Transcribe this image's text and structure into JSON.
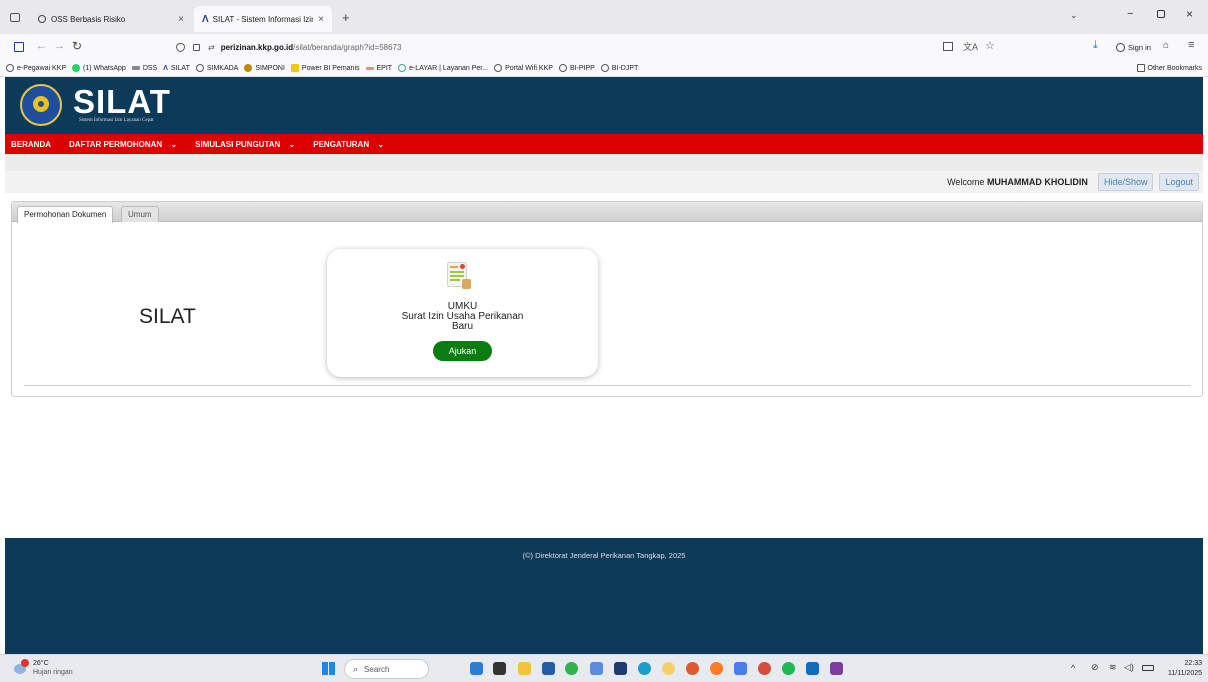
{
  "browser": {
    "tabs": [
      {
        "title": "OSS Berbasis Risiko"
      },
      {
        "title": "SILAT - Sistem Informasi Izin La"
      }
    ],
    "new_tab_symbol": "+",
    "url_host": "perizinan.kkp.go.id",
    "url_path": "/silat/beranda/graph?id=58673",
    "sign_in_label": "Sign in",
    "bookmarks": [
      "e-Pegawai KKP",
      "(1) WhatsApp",
      "DSS",
      "SILAT",
      "SIMKADA",
      "SIMPONI",
      "Power BI Pemanis",
      "EPIT",
      "e-LAYAR | Layanan Per...",
      "Portal Wifi KKP",
      "BI-PIPP",
      "BI-DJPT"
    ],
    "other_bookmarks_label": "Other Bookmarks"
  },
  "header": {
    "logo_text": "SILAT",
    "logo_subtitle": "Sistem Informasi Izin Layanan Cepat"
  },
  "menu": [
    "BERANDA",
    "DAFTAR PERMOHONAN",
    "SIMULASI PUNGUTAN",
    "PENGATURAN"
  ],
  "user": {
    "welcome_prefix": "Welcome",
    "name": "MUHAMMAD KHOLIDIN",
    "hide_show_label": "Hide/Show",
    "logout_label": "Logout"
  },
  "content_tabs": [
    "Permohonan Dokumen",
    "Umum"
  ],
  "main": {
    "title": "SILAT",
    "card_line1": "UMKU",
    "card_line2": "Surat Izin Usaha Perikanan",
    "card_line3": "Baru",
    "action_label": "Ajukan"
  },
  "footer": {
    "copyright": "(©) Direktorat Jenderal Perikanan Tangkap, 2025"
  },
  "taskbar": {
    "weather_temp": "26°C",
    "weather_desc": "Hujan ringan",
    "search_placeholder": "Search",
    "time": "22:33",
    "date": "11/11/2025"
  },
  "colors": {
    "header_bg": "#0d3a58",
    "menu_bg": "#dd0000",
    "action_button": "#0a7d12"
  }
}
